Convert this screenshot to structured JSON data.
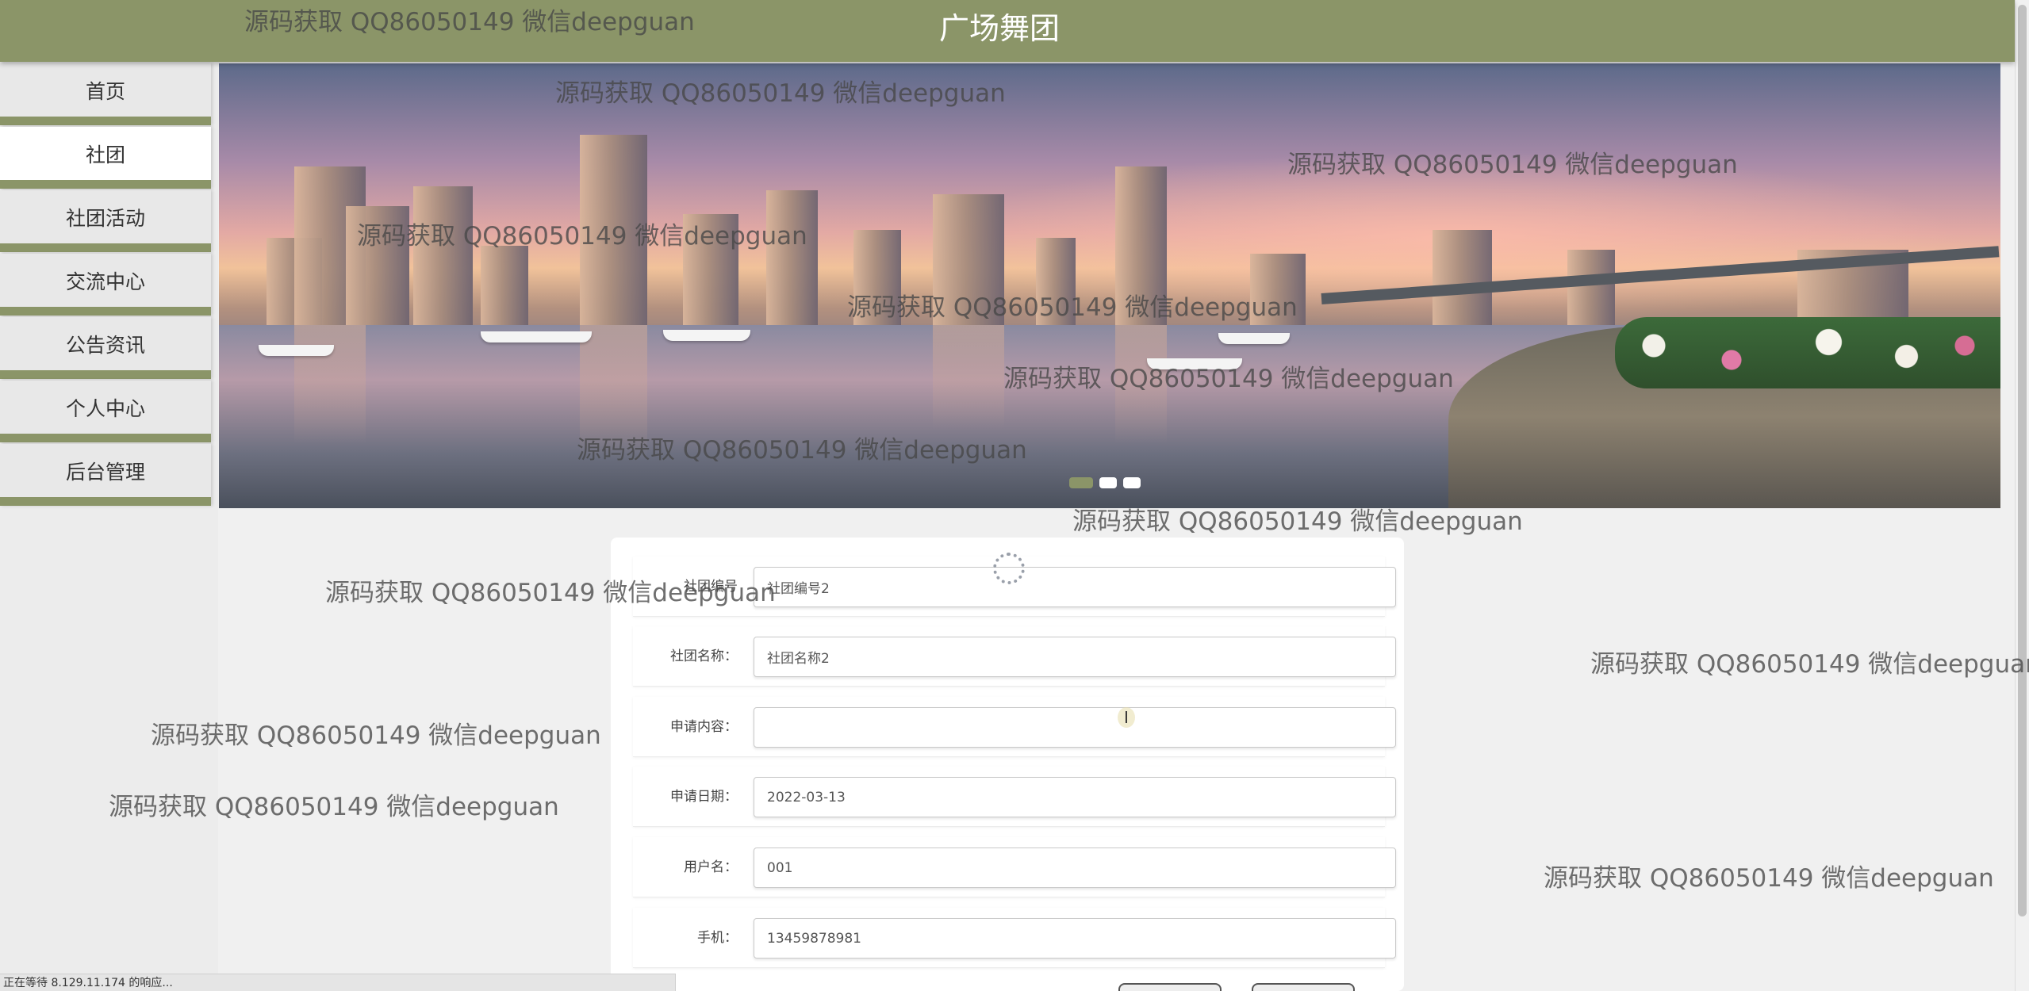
{
  "header": {
    "title": "广场舞团"
  },
  "sidebar": {
    "items": [
      {
        "label": "首页",
        "active": false
      },
      {
        "label": "社团",
        "active": true
      },
      {
        "label": "社团活动",
        "active": false
      },
      {
        "label": "交流中心",
        "active": false
      },
      {
        "label": "公告资讯",
        "active": false
      },
      {
        "label": "个人中心",
        "active": false
      },
      {
        "label": "后台管理",
        "active": false
      }
    ]
  },
  "banner": {
    "slide_count": 3,
    "active_slide": 1
  },
  "form": {
    "fields": [
      {
        "label": "社团编号",
        "value": "社团编号2"
      },
      {
        "label": "社团名称：",
        "value": "社团名称2"
      },
      {
        "label": "申请内容：",
        "value": ""
      },
      {
        "label": "申请日期：",
        "value": "2022-03-13"
      },
      {
        "label": "用户名：",
        "value": "001"
      },
      {
        "label": "手机：",
        "value": "13459878981"
      }
    ]
  },
  "status_bar": {
    "text": "正在等待 8.129.11.174 的响应..."
  },
  "watermark": {
    "text": "源码获取 QQ86050149 微信deepguan"
  },
  "colors": {
    "accent": "#8b9568",
    "background": "#f0f0f0"
  }
}
